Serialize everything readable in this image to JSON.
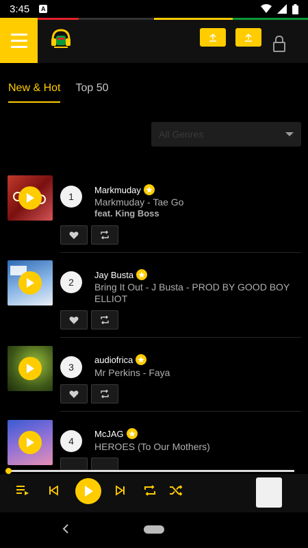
{
  "status_bar": {
    "time": "3:45",
    "notif_letter": "A"
  },
  "colors": {
    "accent": "#FFCC00",
    "stripe_red": "#E4212B",
    "stripe_dark": "#333333",
    "stripe_yellow": "#FFCC00",
    "stripe_green": "#0A9A3A"
  },
  "tabs": [
    {
      "label": "New & Hot",
      "active": true
    },
    {
      "label": "Top 50",
      "active": false
    }
  ],
  "genre_select": {
    "selected": "All Genres"
  },
  "tracks": [
    {
      "rank": "1",
      "artist": "Markmuday",
      "title": "Markmuday - Tae Go",
      "feat": "feat. King Boss"
    },
    {
      "rank": "2",
      "artist": "Jay Busta",
      "title": "Bring It Out - J Busta - PROD BY GOOD BOY ELLIOT",
      "feat": ""
    },
    {
      "rank": "3",
      "artist": "audiofrica",
      "title": "Mr Perkins - Faya",
      "feat": ""
    },
    {
      "rank": "4",
      "artist": "McJAG",
      "title": "HEROES (To Our Mothers)",
      "feat": ""
    }
  ],
  "player": {
    "progress": 0.0
  },
  "icons": [
    "menu-icon",
    "upload-icon",
    "lock-icon",
    "play-icon",
    "heart-icon",
    "repost-icon",
    "queue-icon",
    "previous-icon",
    "next-icon",
    "repeat-icon",
    "shuffle-icon",
    "back-icon"
  ]
}
